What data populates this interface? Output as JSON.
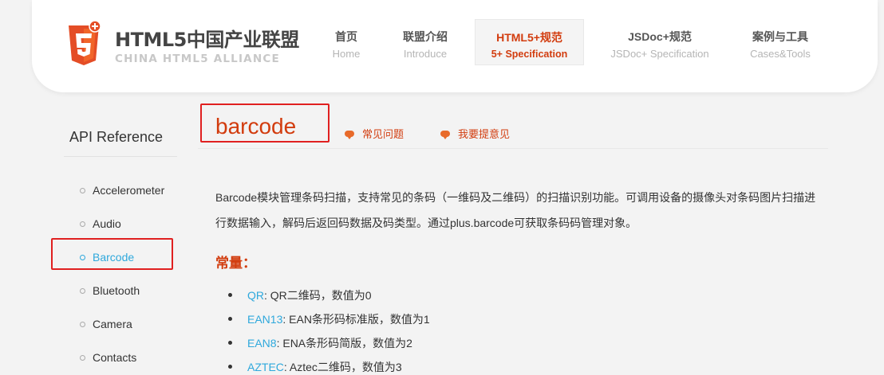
{
  "header": {
    "logo_badge": "5",
    "logo_title": "HTML5中国产业联盟",
    "logo_subtitle": "CHINA HTML5 ALLIANCE",
    "nav": [
      {
        "cn": "首页",
        "en": "Home"
      },
      {
        "cn": "联盟介绍",
        "en": "Introduce"
      },
      {
        "cn": "HTML5+规范",
        "en": "5+ Specification",
        "active": true
      },
      {
        "cn": "JSDoc+规范",
        "en": "JSDoc+ Specification"
      },
      {
        "cn": "案例与工具",
        "en": "Cases&Tools"
      }
    ]
  },
  "sidebar": {
    "title": "API Reference",
    "items": [
      {
        "label": "Accelerometer"
      },
      {
        "label": "Audio"
      },
      {
        "label": "Barcode",
        "active": true
      },
      {
        "label": "Bluetooth"
      },
      {
        "label": "Camera"
      },
      {
        "label": "Contacts"
      }
    ]
  },
  "main": {
    "title": "barcode",
    "links": [
      "常见问题",
      "我要提意见"
    ],
    "description_line1": "Barcode模块管理条码扫描，支持常见的条码（一维码及二维码）的扫描识别功能。可调用设备的摄像头对条码图片扫描进",
    "description_line2": "行数据输入，解码后返回码数据及码类型。通过plus.barcode可获取条码码管理对象。",
    "constants_heading": "常量：",
    "constants": [
      {
        "name": "QR",
        "text": ": QR二维码，数值为0"
      },
      {
        "name": "EAN13",
        "text": ": EAN条形码标准版，数值为1"
      },
      {
        "name": "EAN8",
        "text": ": ENA条形码简版，数值为2"
      },
      {
        "name": "AZTEC",
        "text": ": Aztec二维码，数值为3"
      }
    ]
  },
  "colors": {
    "accent": "#d23c0e",
    "link": "#2ea8dc",
    "highlight": "#e02020",
    "logo_orange": "#e44d26"
  }
}
